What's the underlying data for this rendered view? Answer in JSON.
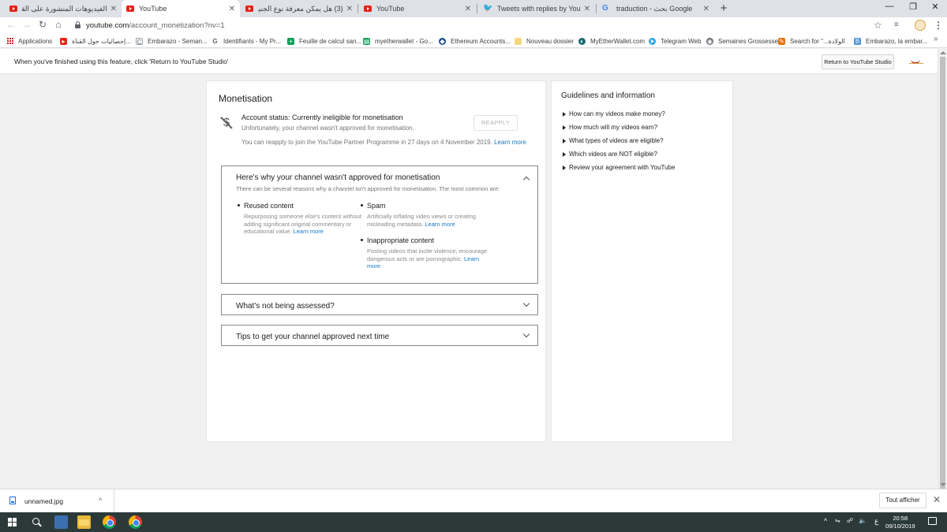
{
  "browser": {
    "tabs": [
      {
        "label": "الفيديوهات المنشورة على القناة - ",
        "icon": "youtube-favicon",
        "active": false
      },
      {
        "label": "YouTube",
        "icon": "youtube-favicon",
        "active": true
      },
      {
        "label": "(3) هل يمكن معرفة نوع الجنين من",
        "icon": "youtube-favicon",
        "active": false
      },
      {
        "label": "YouTube",
        "icon": "youtube-favicon",
        "active": false
      },
      {
        "label": "Tweets with replies by YouTube C",
        "icon": "twitter-favicon",
        "active": false
      },
      {
        "label": "traduction - بحث Google",
        "icon": "google-favicon",
        "active": false
      }
    ],
    "new_tab_glyph": "+",
    "url_host": "youtube.com",
    "url_path": "/account_monetization?nv=1",
    "bookmarks": [
      {
        "label": "Applications",
        "icon": "apps-icon"
      },
      {
        "label": "إحصائيات حول القناة...",
        "icon": "youtube-icon"
      },
      {
        "label": "Embarazo - Seman...",
        "icon": "bookmark-icon"
      },
      {
        "label": "Identifiants - My Pr...",
        "icon": "google-icon"
      },
      {
        "label": "Feuille de calcul san...",
        "icon": "sheets-icon"
      },
      {
        "label": "myetherwallet - Go...",
        "icon": "sheets-icon"
      },
      {
        "label": "Ethereum Accounts...",
        "icon": "ethereum-icon"
      },
      {
        "label": "Nouveau dossier",
        "icon": "folder-icon"
      },
      {
        "label": "MyEtherWallet.com",
        "icon": "mew-icon"
      },
      {
        "label": "Telegram Web",
        "icon": "telegram-icon"
      },
      {
        "label": "Semaines Grossesse",
        "icon": "globe-icon"
      },
      {
        "label": "Search for \"...الولادة",
        "icon": "bookmark-icon"
      },
      {
        "label": "Embarazo, la embar...",
        "icon": "bookmark-icon"
      }
    ]
  },
  "studio_banner": {
    "message": "When you've finished using this feature, click 'Return to YouTube Studio'",
    "return_button": "Return to YouTube Studio"
  },
  "monetisation": {
    "title": "Monetisation",
    "status_title": "Account status: Currently ineligible for monetisation",
    "status_sub": "Unfortunately, your channel wasn't approved for monetisation.",
    "reapply_button": "REAPPLY",
    "reapply_note": "You can reapply to join the YouTube Partner Programme in 27 days on 4 November 2019.",
    "learn_more": "Learn more",
    "why_panel": {
      "title": "Here's why your channel wasn't approved for monetisation",
      "subtitle": "There can be several reasons why a channel isn't approved for monetisation. The most common are:",
      "reasons": [
        {
          "title": "Reused content",
          "body": "Repurposing someone else's content without adding significant original commentary or educational value.",
          "link": "Learn more"
        },
        {
          "title": "Spam",
          "body": "Artificially inflating video views or creating misleading metadata.",
          "link": "Learn more"
        },
        {
          "title": "Inappropriate content",
          "body": "Posting videos that incite violence, encourage dangerous acts or are pornographic.",
          "link": "Learn more"
        }
      ]
    },
    "not_assessed_panel": {
      "title": "What's not being assessed?"
    },
    "tips_panel": {
      "title": "Tips to get your channel approved next time"
    }
  },
  "guidelines": {
    "title": "Guidelines and information",
    "items": [
      "How can my videos make money?",
      "How much will my videos earn?",
      "What types of videos are eligible?",
      "Which videos are NOT eligible?",
      "Review your agreement with YouTube"
    ]
  },
  "downloads": {
    "file_name": "unnamed.jpg",
    "show_all": "Tout afficher"
  },
  "taskbar": {
    "time": "20:58",
    "date": "09/10/2019",
    "lang": "ع"
  }
}
